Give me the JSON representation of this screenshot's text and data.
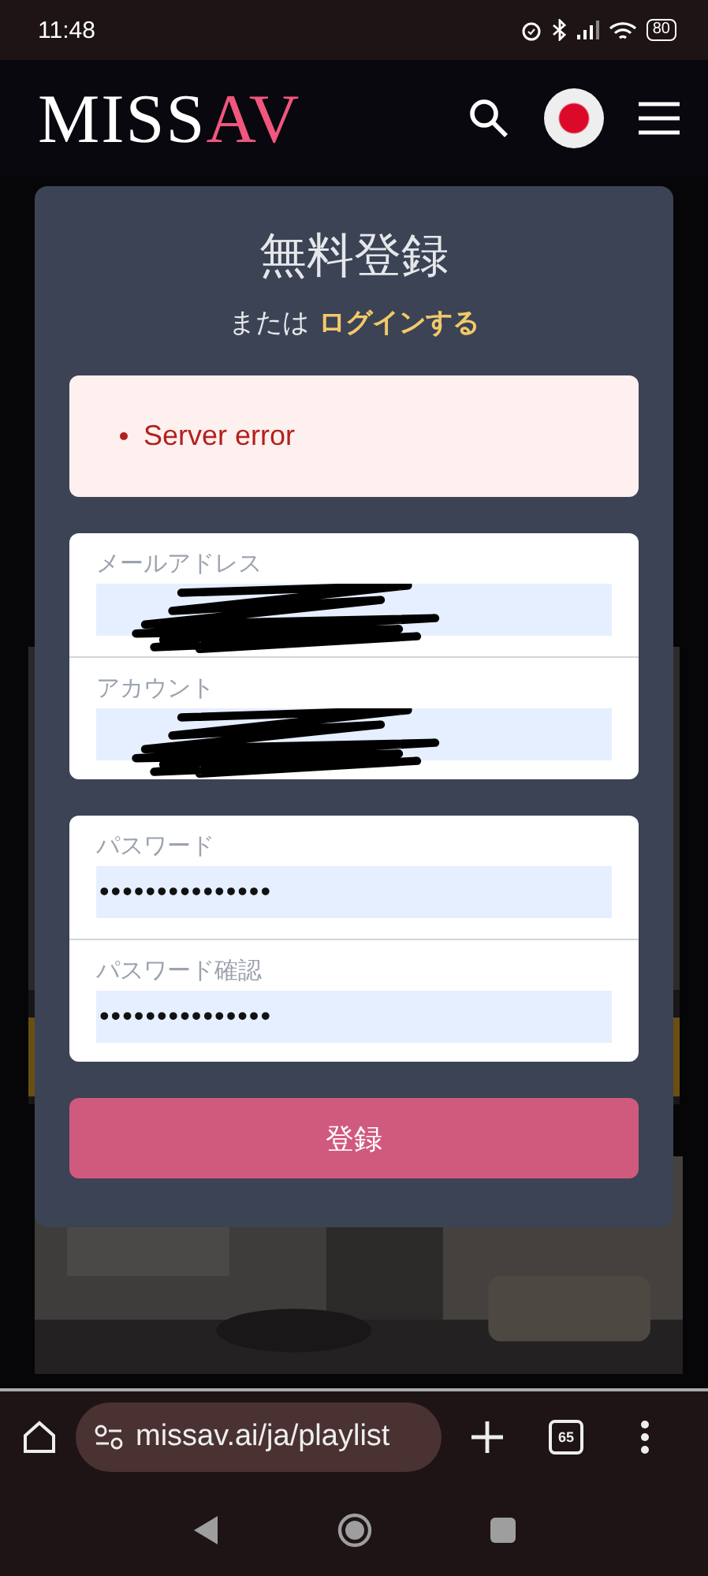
{
  "status_bar": {
    "time": "11:48",
    "battery": "80"
  },
  "header": {
    "logo": [
      {
        "text": "MISS",
        "accent": false
      },
      {
        "text": "AV",
        "accent": true
      }
    ]
  },
  "modal": {
    "title": "無料登録",
    "subtitle": "または",
    "login_link": "ログインする",
    "errors": [
      "Server error"
    ],
    "field_groups": [
      [
        {
          "label": "メールアドレス",
          "redacted": true
        },
        {
          "label": "アカウント",
          "redacted": true
        }
      ],
      [
        {
          "label": "パスワード",
          "value": "•••••••••••••••",
          "redacted": false
        },
        {
          "label": "パスワード確認",
          "value": "•••••••••••••••",
          "redacted": false
        }
      ]
    ],
    "submit": "登録"
  },
  "browser": {
    "url": "missav.ai/ja/playlist",
    "tab_count": "65"
  }
}
